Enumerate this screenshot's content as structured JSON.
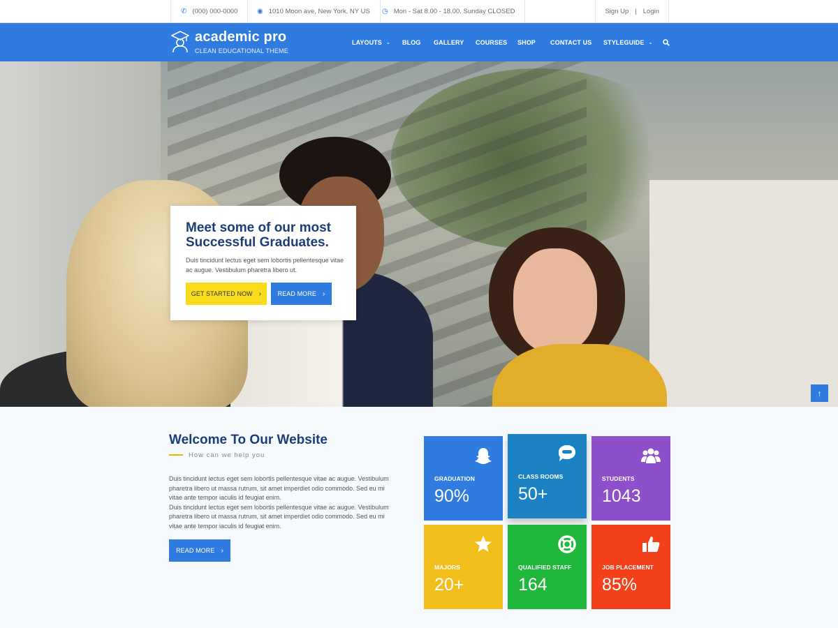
{
  "topbar": {
    "phone": "(000) 000-0000",
    "address": "1010 Moon ave, New York, NY US",
    "hours": "Mon - Sat 8.00 - 18.00. Sunday CLOSED",
    "signup": "Sign Up",
    "separator": "|",
    "login": "Login"
  },
  "brand": {
    "title": "academic pro",
    "subtitle": "CLEAN EDUCATIONAL THEME"
  },
  "nav": {
    "items": [
      "LAYOUTS",
      "BLOG",
      "GALLERY",
      "COURSES",
      "SHOP",
      "CONTACT US",
      "STYLEGUIDE"
    ],
    "dropdown_items": [
      "LAYOUTS",
      "STYLEGUIDE"
    ]
  },
  "hero": {
    "title": "Meet some of our most Successful Graduates.",
    "description": "Duis tincidunt lectus eget sem lobortis pellentesque vitae ac augue. Vestibulum pharetra libero ut.",
    "primary_button": "GET STARTED NOW",
    "secondary_button": "READ MORE"
  },
  "welcome": {
    "title": "Welcome To Our Website",
    "subtitle": "How can we help you",
    "paragraph1": "Duis tincidunt lectus eget sem lobortis pellentesque vitae ac augue. Vestibulum pharetra libero ut massa rutrum, sit amet imperdiet odio commodo. Sed eu mi vitae ante tempor iaculis id feugiat enim.",
    "paragraph2": "Duis tincidunt lectus eget sem lobortis pellentesque vitae ac augue. Vestibulum pharetra libero ut massa rutrum, sit amet imperdiet odio commodo. Sed eu mi vitae ante tempor iaculis id feugiat enim.",
    "button": "READ MORE"
  },
  "stats": [
    {
      "label": "GRADUATION",
      "value": "90%",
      "color": "#2f7be0",
      "icon": "snapchat-ghost-icon"
    },
    {
      "label": "CLASS ROOMS",
      "value": "50+",
      "color": "#1b83c4",
      "icon": "chat-face-icon"
    },
    {
      "label": "STUDENTS",
      "value": "1043",
      "color": "#8e4fcb",
      "icon": "users-icon"
    },
    {
      "label": "MAJORS",
      "value": "20+",
      "color": "#f2be1c",
      "icon": "star-icon"
    },
    {
      "label": "QUALIFIED STAFF",
      "value": "164",
      "color": "#1fb73c",
      "icon": "lifebuoy-icon"
    },
    {
      "label": "JOB PLACEMENT",
      "value": "85%",
      "color": "#f5401c",
      "icon": "thumbs-up-icon"
    }
  ],
  "colors": {
    "primary": "#2f7be0",
    "accent_yellow": "#f7dc1e",
    "heading_navy": "#1b3e78"
  }
}
